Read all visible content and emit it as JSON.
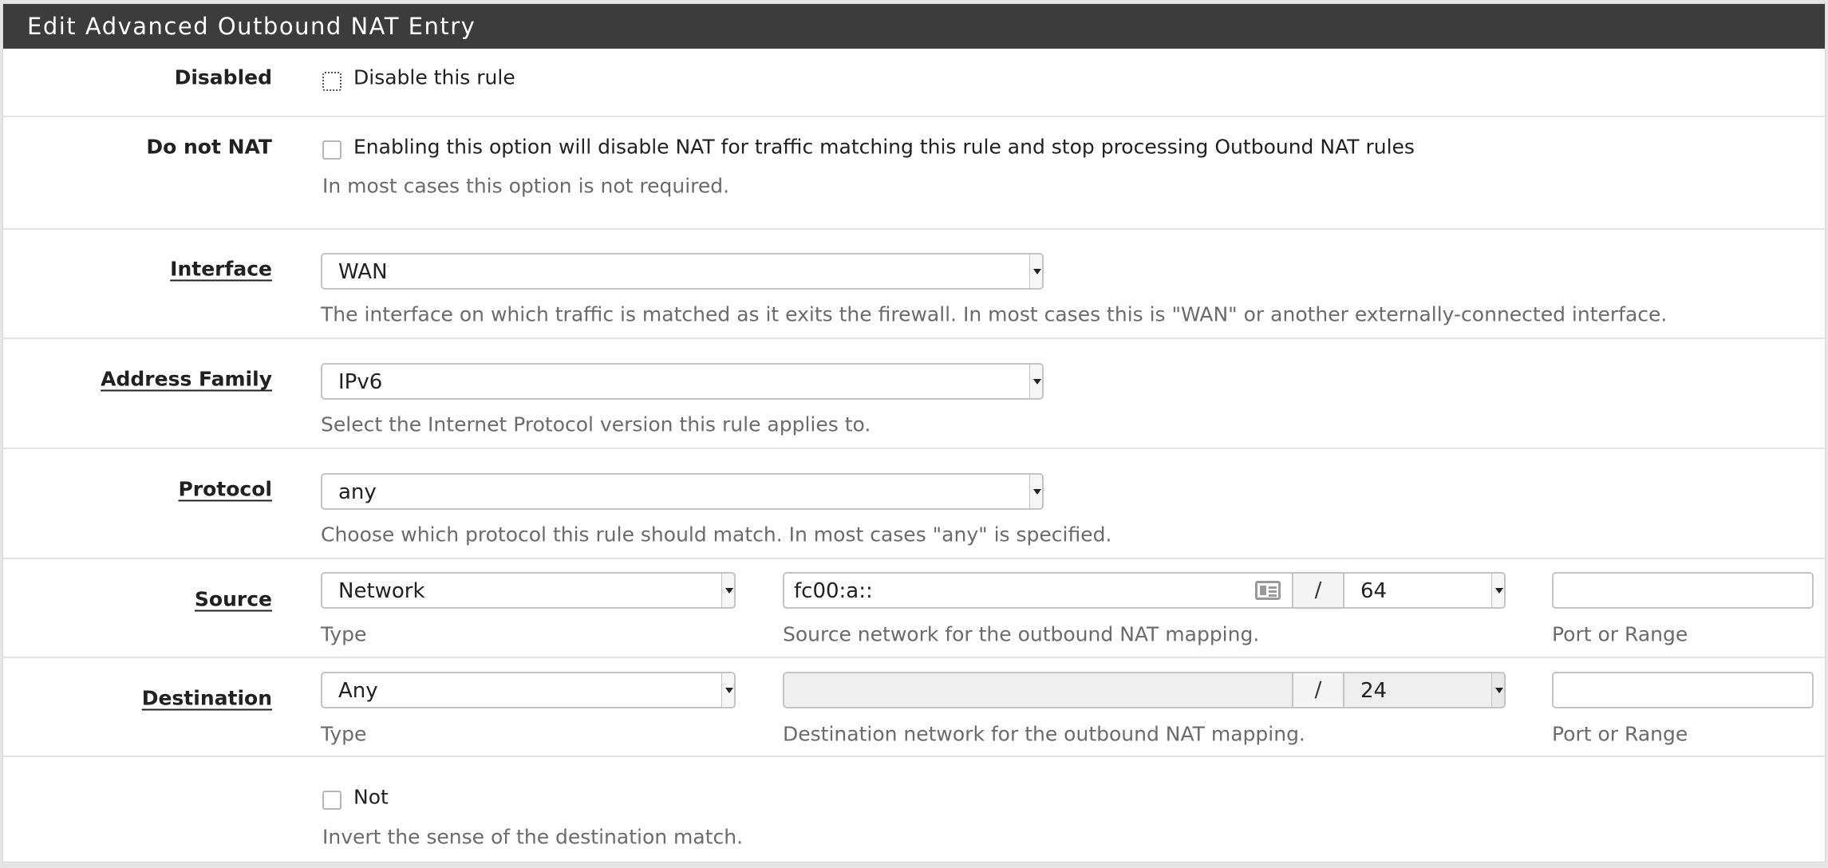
{
  "panel": {
    "title": "Edit Advanced Outbound NAT Entry"
  },
  "disabled": {
    "label": "Disabled",
    "checkbox_text": "Disable this rule",
    "checked": false
  },
  "nonat": {
    "label": "Do not NAT",
    "checkbox_text": "Enabling this option will disable NAT for traffic matching this rule and stop processing Outbound NAT rules",
    "help": "In most cases this option is not required.",
    "checked": false
  },
  "interface": {
    "label": "Interface",
    "value": "WAN",
    "help": "The interface on which traffic is matched as it exits the firewall. In most cases this is \"WAN\" or another externally-connected interface."
  },
  "address_family": {
    "label": "Address Family",
    "value": "IPv6",
    "help": "Select the Internet Protocol version this rule applies to."
  },
  "protocol": {
    "label": "Protocol",
    "value": "any",
    "help": "Choose which protocol this rule should match. In most cases \"any\" is specified."
  },
  "source": {
    "label": "Source",
    "type_value": "Network",
    "type_help": "Type",
    "network_value": "fc00:a::",
    "separator": "/",
    "mask_value": "64",
    "network_help": "Source network for the outbound NAT mapping.",
    "port_value": "",
    "port_help": "Port or Range"
  },
  "destination": {
    "label": "Destination",
    "type_value": "Any",
    "type_help": "Type",
    "network_value": "",
    "separator": "/",
    "mask_value": "24",
    "network_help": "Destination network for the outbound NAT mapping.",
    "port_value": "",
    "port_help": "Port or Range"
  },
  "not": {
    "checkbox_text": "Not",
    "help": "Invert the sense of the destination match.",
    "checked": false
  },
  "icons": {
    "network_field_icon": "address-card-icon"
  }
}
